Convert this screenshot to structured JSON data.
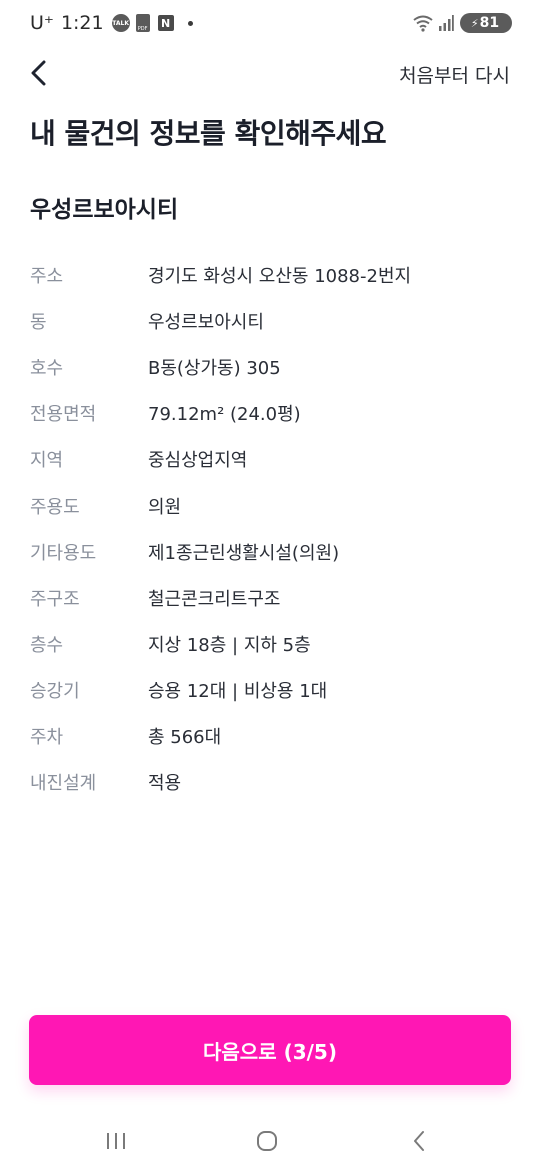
{
  "status_bar": {
    "carrier": "U⁺",
    "time": "1:21",
    "talk_icon_text": "TALK",
    "pdf_icon_text": "PDF",
    "n_icon_text": "N",
    "battery": "81"
  },
  "header": {
    "back_icon": "chevron-left-icon",
    "restart_label": "처음부터 다시"
  },
  "page": {
    "title": "내 물건의 정보를 확인해주세요",
    "building_name": "우성르보아시티"
  },
  "info": [
    {
      "label": "주소",
      "value": "경기도 화성시 오산동 1088-2번지"
    },
    {
      "label": "동",
      "value": "우성르보아시티"
    },
    {
      "label": "호수",
      "value": "B동(상가동) 305"
    },
    {
      "label": "전용면적",
      "value": "79.12m² (24.0평)"
    },
    {
      "label": "지역",
      "value": "중심상업지역"
    },
    {
      "label": "주용도",
      "value": "의원"
    },
    {
      "label": "기타용도",
      "value": "제1종근린생활시설(의원)"
    },
    {
      "label": "주구조",
      "value": "철근콘크리트구조"
    },
    {
      "label": "층수",
      "value": "지상 18층 | 지하 5층"
    },
    {
      "label": "승강기",
      "value": "승용 12대 | 비상용 1대"
    },
    {
      "label": "주차",
      "value": "총 566대"
    },
    {
      "label": "내진설계",
      "value": "적용"
    }
  ],
  "footer": {
    "next_label": "다음으로 (3/5)"
  },
  "colors": {
    "accent": "#ff17b4",
    "label_gray": "#8a909c",
    "text_dark": "#1b1f2a"
  }
}
